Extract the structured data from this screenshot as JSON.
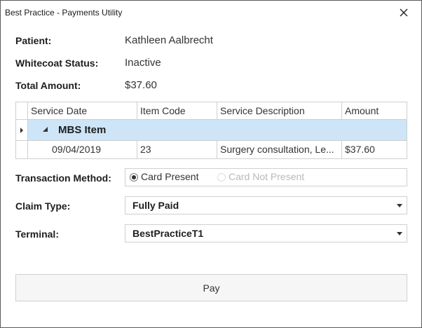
{
  "window": {
    "title": "Best Practice - Payments Utility"
  },
  "icons": {
    "close": "close-icon",
    "expand": "collapse-triangle-icon",
    "row_pointer": "row-pointer-icon",
    "dropdown": "chevron-down-icon"
  },
  "patient": {
    "label": "Patient:",
    "value": "Kathleen Aalbrecht"
  },
  "whitecoat": {
    "label": "Whitecoat Status:",
    "value": "Inactive"
  },
  "total": {
    "label": "Total Amount:",
    "value": "$37.60"
  },
  "grid": {
    "columns": [
      "Service Date",
      "Item Code",
      "Service Description",
      "Amount"
    ],
    "group": "MBS Item",
    "rows": [
      {
        "date": "09/04/2019",
        "code": "23",
        "description": "Surgery consultation, Le...",
        "amount": "$37.60"
      }
    ]
  },
  "transaction": {
    "label": "Transaction Method:",
    "options": [
      {
        "label": "Card Present",
        "selected": true,
        "enabled": true
      },
      {
        "label": "Card Not Present",
        "selected": false,
        "enabled": false
      }
    ]
  },
  "claim_type": {
    "label": "Claim Type:",
    "value": "Fully Paid"
  },
  "terminal": {
    "label": "Terminal:",
    "value": "BestPracticeT1"
  },
  "pay_button": {
    "label": "Pay"
  },
  "colors": {
    "selected_row": "#cde5f7",
    "border": "#cfcfcf",
    "disabled_text": "#b9b9b9"
  }
}
